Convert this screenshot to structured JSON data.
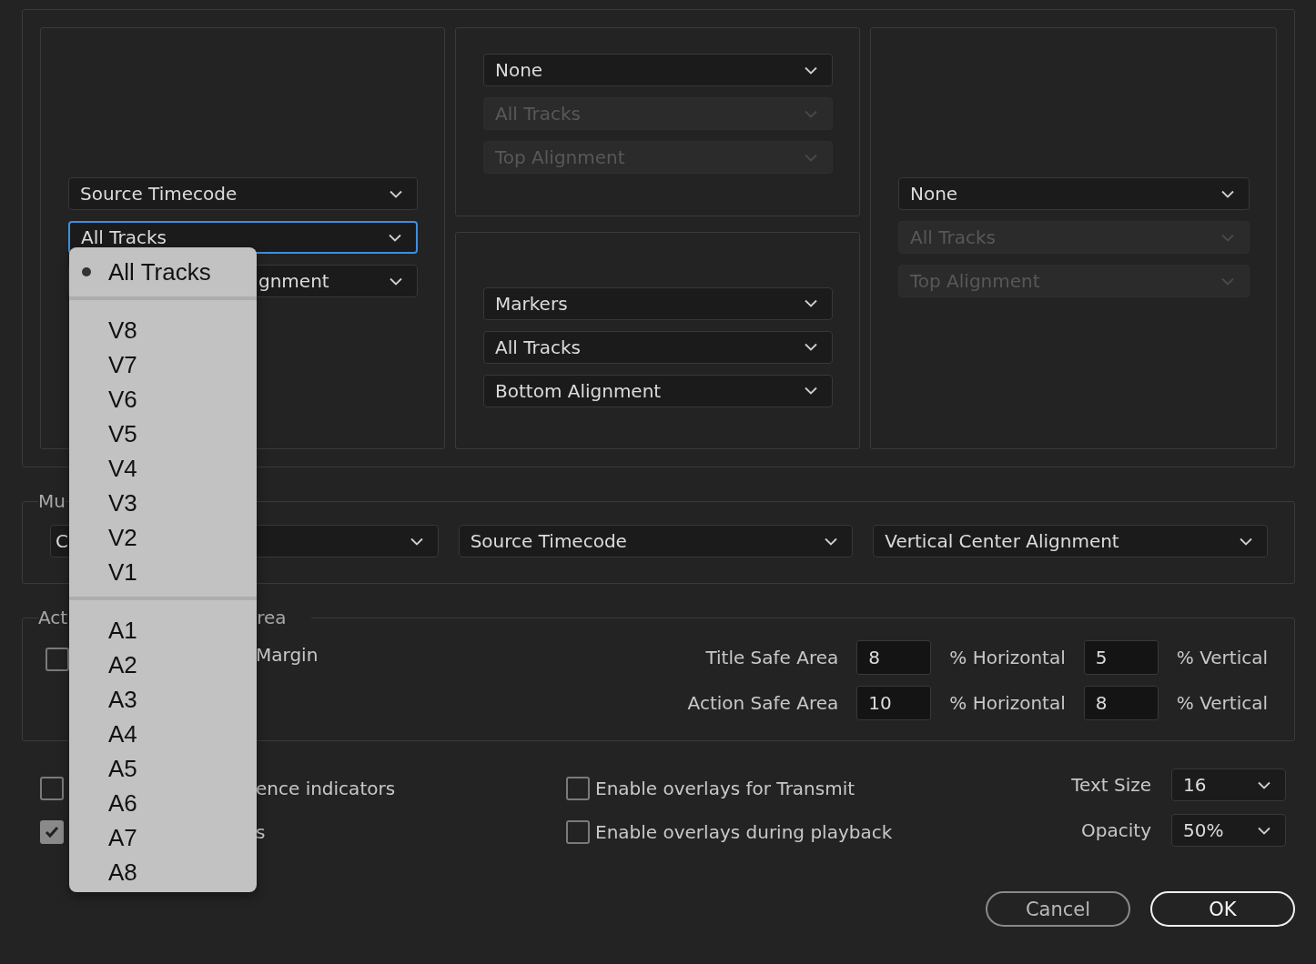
{
  "panels": [
    {
      "dropdowns": [
        {
          "value": "Source Timecode",
          "disabled": false,
          "focused": false
        },
        {
          "value": "All Tracks",
          "disabled": false,
          "focused": true
        },
        {
          "value": "gnment",
          "disabled": false,
          "focused": false
        }
      ]
    },
    {
      "dropdowns": [
        {
          "value": "None",
          "disabled": false,
          "focused": false
        },
        {
          "value": "All Tracks",
          "disabled": true,
          "focused": false
        },
        {
          "value": "Top Alignment",
          "disabled": true,
          "focused": false
        }
      ]
    },
    {
      "dropdowns": [
        {
          "value": "Markers",
          "disabled": false,
          "focused": false
        },
        {
          "value": "All Tracks",
          "disabled": false,
          "focused": false
        },
        {
          "value": "Bottom Alignment",
          "disabled": false,
          "focused": false
        }
      ]
    },
    {
      "dropdowns": [
        {
          "value": "None",
          "disabled": false,
          "focused": false
        },
        {
          "value": "All Tracks",
          "disabled": true,
          "focused": false
        },
        {
          "value": "Top Alignment",
          "disabled": true,
          "focused": false
        }
      ]
    }
  ],
  "multicam": {
    "legend": "Mu",
    "dropdowns": [
      {
        "value": "C"
      },
      {
        "value": "Source Timecode"
      },
      {
        "value": "Vertical Center Alignment"
      }
    ]
  },
  "safe_area": {
    "legend_parts": [
      "Act",
      "rea"
    ],
    "margin_checkbox": {
      "label": "Margin",
      "checked": false
    },
    "rows": [
      {
        "label": "Title Safe Area",
        "horizontal": "8",
        "horizontal_unit": "% Horizontal",
        "vertical": "5",
        "vertical_unit": "% Vertical"
      },
      {
        "label": "Action Safe Area",
        "horizontal": "10",
        "horizontal_unit": "% Horizontal",
        "vertical": "8",
        "vertical_unit": "% Vertical"
      }
    ]
  },
  "options": {
    "checkboxes": [
      {
        "label": "ence indicators",
        "checked": false
      },
      {
        "label": "s",
        "checked": true
      },
      {
        "label": "Enable overlays for Transmit",
        "checked": false
      },
      {
        "label": "Enable overlays during playback",
        "checked": false
      }
    ],
    "text_size": {
      "label": "Text Size",
      "value": "16"
    },
    "opacity": {
      "label": "Opacity",
      "value": "50%"
    }
  },
  "buttons": [
    {
      "label": "Cancel",
      "default": false
    },
    {
      "label": "OK",
      "default": true
    }
  ],
  "dropdown_menu": {
    "groups": [
      [
        {
          "label": "All Tracks",
          "selected": true
        }
      ],
      [
        {
          "label": "V8",
          "selected": false
        },
        {
          "label": "V7",
          "selected": false
        },
        {
          "label": "V6",
          "selected": false
        },
        {
          "label": "V5",
          "selected": false
        },
        {
          "label": "V4",
          "selected": false
        },
        {
          "label": "V3",
          "selected": false
        },
        {
          "label": "V2",
          "selected": false
        },
        {
          "label": "V1",
          "selected": false
        }
      ],
      [
        {
          "label": "A1",
          "selected": false
        },
        {
          "label": "A2",
          "selected": false
        },
        {
          "label": "A3",
          "selected": false
        },
        {
          "label": "A4",
          "selected": false
        },
        {
          "label": "A5",
          "selected": false
        },
        {
          "label": "A6",
          "selected": false
        },
        {
          "label": "A7",
          "selected": false
        },
        {
          "label": "A8",
          "selected": false
        }
      ]
    ]
  }
}
